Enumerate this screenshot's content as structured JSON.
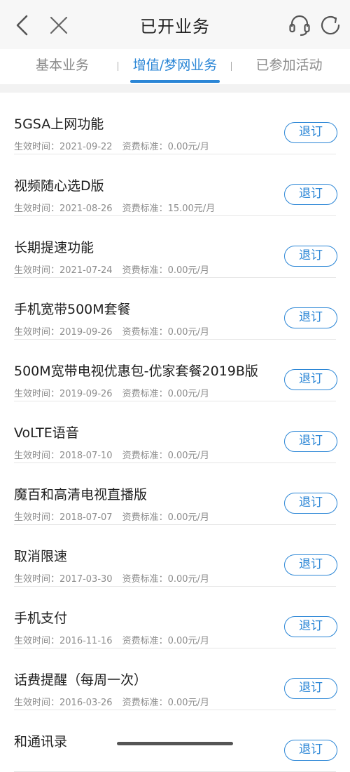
{
  "header": {
    "title": "已开业务",
    "icons": [
      "back-icon",
      "close-icon",
      "headset-icon",
      "refresh-icon"
    ]
  },
  "tabs": [
    {
      "label": "基本业务",
      "active": false
    },
    {
      "label": "增值/梦网业务",
      "active": true
    },
    {
      "label": "已参加活动",
      "active": false
    }
  ],
  "colors": {
    "accent": "#2b86d6",
    "text": "#1e1e1e",
    "meta": "#8c8c8c"
  },
  "list": {
    "date_label": "生效时间：",
    "fee_label": "资费标准：",
    "unsubscribe_label": "退订",
    "items": [
      {
        "name": "5GSA上网功能",
        "date": "2021-09-22",
        "fee": "0.00元/月"
      },
      {
        "name": "视频随心选D版",
        "date": "2021-08-26",
        "fee": "15.00元/月"
      },
      {
        "name": "长期提速功能",
        "date": "2021-07-24",
        "fee": "0.00元/月"
      },
      {
        "name": "手机宽带500M套餐",
        "date": "2019-09-26",
        "fee": "0.00元/月"
      },
      {
        "name": "500M宽带电视优惠包-优家套餐2019B版",
        "date": "2019-09-26",
        "fee": "0.00元/月"
      },
      {
        "name": "VoLTE语音",
        "date": "2018-07-10",
        "fee": "0.00元/月"
      },
      {
        "name": "魔百和高清电视直播版",
        "date": "2018-07-07",
        "fee": "0.00元/月"
      },
      {
        "name": "取消限速",
        "date": "2017-03-30",
        "fee": "0.00元/月"
      },
      {
        "name": "手机支付",
        "date": "2016-11-16",
        "fee": "0.00元/月"
      },
      {
        "name": "话费提醒（每周一次）",
        "date": "2016-03-26",
        "fee": "0.00元/月"
      },
      {
        "name": "和通讯录",
        "date": "",
        "fee": ""
      }
    ]
  }
}
